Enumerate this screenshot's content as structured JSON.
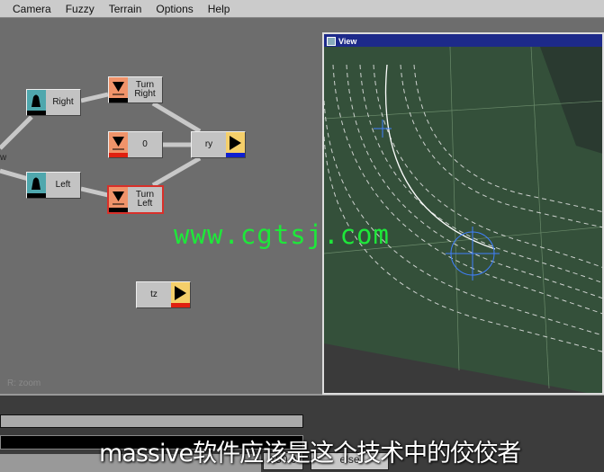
{
  "menu": [
    "Camera",
    "Fuzzy",
    "Terrain",
    "Options",
    "Help"
  ],
  "nodes": {
    "right": "Right",
    "turn_right": "Turn Right",
    "zero": "0",
    "ry": "ry",
    "left": "Left",
    "turn_left": "Turn Left",
    "tz": "tz",
    "partial_label": "w"
  },
  "hint": "R: zoom",
  "view": {
    "title": "View"
  },
  "watermark": "www.cgtsj.com",
  "bottom": {
    "value_box": "150.0",
    "else_box": "else"
  },
  "subtitle": "massive软件应该是这个技术中的佼佼者",
  "colors": {
    "accent_teal": "#4fa7ad",
    "accent_orange": "#f0936a",
    "output_yellow": "#f5cf6a",
    "selected_border": "#d8302a"
  }
}
